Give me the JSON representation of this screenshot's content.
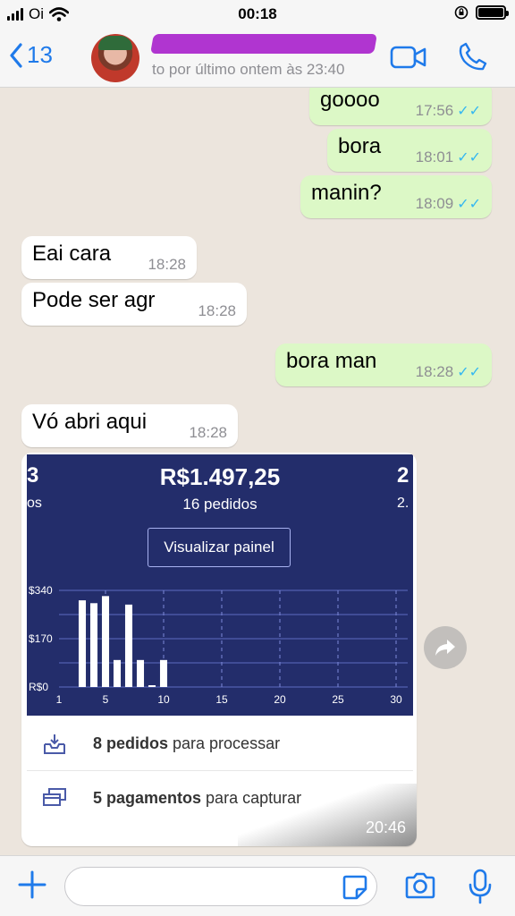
{
  "status_bar": {
    "carrier": "Oi",
    "time": "00:18"
  },
  "header": {
    "back_count": "13",
    "contact_status": "to por último ontem às 23:40"
  },
  "messages": [
    {
      "text": "goooo",
      "time": "17:56",
      "direction": "out"
    },
    {
      "text": "bora",
      "time": "18:01",
      "direction": "out"
    },
    {
      "text": "manin?",
      "time": "18:09",
      "direction": "out"
    },
    {
      "text": "Eai cara",
      "time": "18:28",
      "direction": "in"
    },
    {
      "text": "Pode ser agr",
      "time": "18:28",
      "direction": "in"
    },
    {
      "text": "bora man",
      "time": "18:28",
      "direction": "out"
    },
    {
      "text": "Vó abri aqui",
      "time": "18:28",
      "direction": "in"
    }
  ],
  "image_message": {
    "time": "20:46",
    "kpi_left": {
      "value": "3",
      "label": "os"
    },
    "kpi_center": {
      "value": "R$1.497,25",
      "label": "16 pedidos"
    },
    "kpi_right": {
      "value": "2",
      "label": "2."
    },
    "panel_button": "Visualizar painel",
    "row1": {
      "bold": "8 pedidos",
      "rest": "para processar"
    },
    "row2": {
      "bold": "5 pagamentos",
      "rest": "para capturar"
    }
  },
  "chart_data": {
    "type": "bar",
    "ytick_labels": [
      "R$0",
      "$170",
      "$340"
    ],
    "xtick_labels": [
      "1",
      "5",
      "10",
      "15",
      "20",
      "25",
      "30"
    ],
    "ylim": [
      0,
      340
    ],
    "xlim": [
      1,
      31
    ],
    "x": [
      3,
      4,
      5,
      6,
      7,
      8,
      9,
      10
    ],
    "values": [
      305,
      295,
      320,
      95,
      290,
      95,
      0,
      95
    ],
    "grid": true
  },
  "composer": {
    "placeholder": ""
  },
  "colors": {
    "outgoing": "#dcf8c6",
    "incoming": "#ffffff",
    "accent": "#1f7aea",
    "panel": "#232d6b",
    "read_ticks": "#34b7f1"
  },
  "icons": [
    "back-chevron-icon",
    "video-call-icon",
    "phone-icon",
    "forward-icon",
    "inbox-download-icon",
    "card-stack-icon",
    "plus-icon",
    "sticker-icon",
    "camera-icon",
    "mic-icon"
  ]
}
